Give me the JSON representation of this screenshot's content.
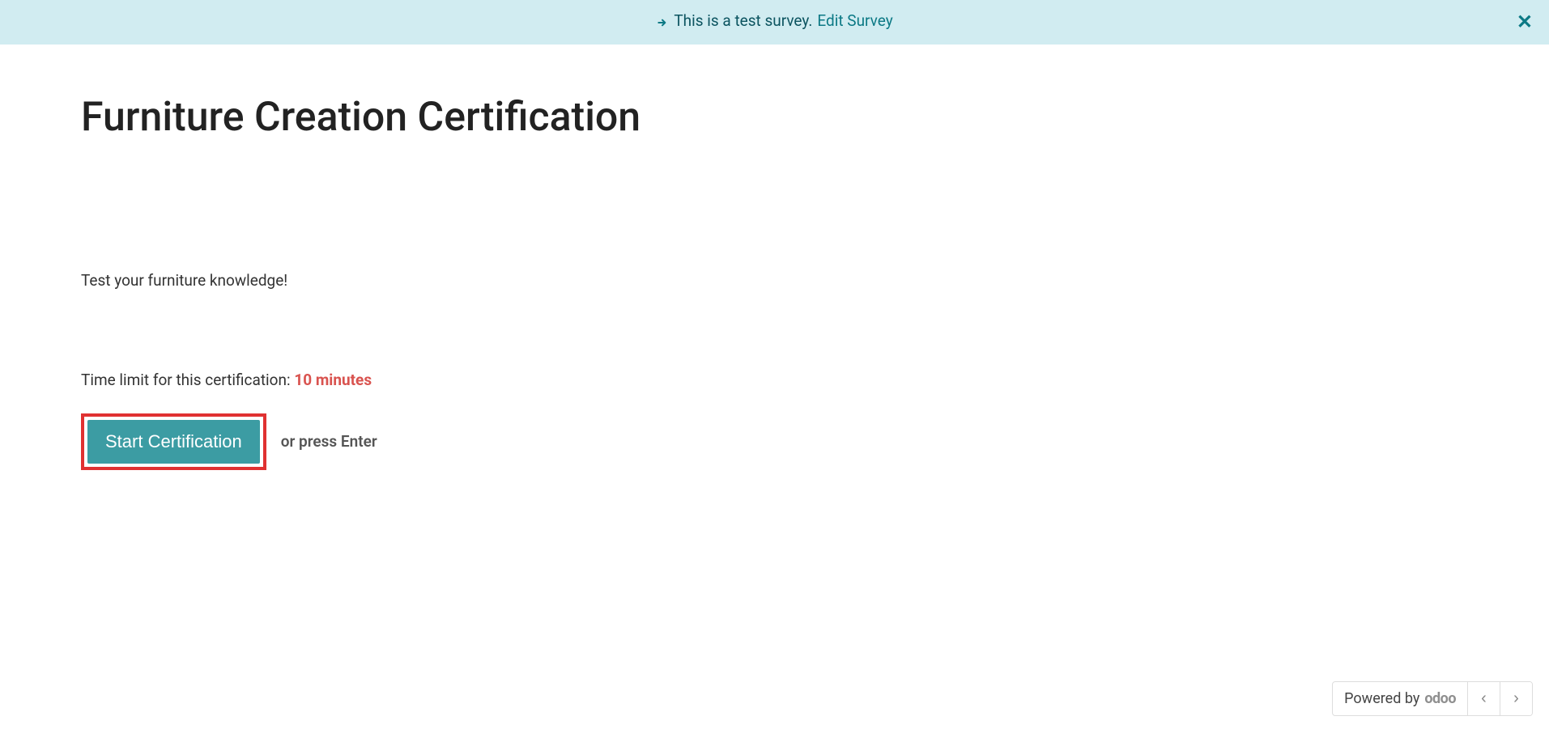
{
  "banner": {
    "message": "This is a test survey.",
    "edit_link": "Edit Survey"
  },
  "main": {
    "title": "Furniture Creation Certification",
    "subtitle": "Test your furniture knowledge!",
    "time_limit_label": "Time limit for this certification:",
    "time_limit_value": "10 minutes",
    "start_button": "Start Certification",
    "press_enter": "or press Enter"
  },
  "footer": {
    "powered_by": "Powered by",
    "brand": "odoo"
  }
}
